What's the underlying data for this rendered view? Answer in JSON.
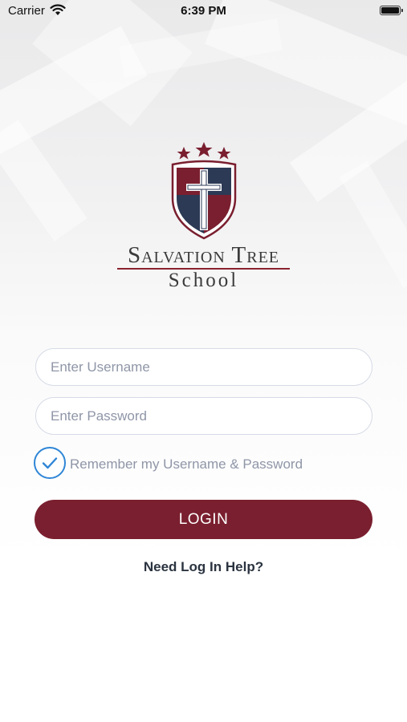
{
  "status_bar": {
    "carrier": "Carrier",
    "time": "6:39 PM"
  },
  "brand": {
    "line1": "Salvation Tree",
    "line2": "School"
  },
  "form": {
    "username": {
      "placeholder": "Enter Username",
      "value": ""
    },
    "password": {
      "placeholder": "Enter Password",
      "value": ""
    },
    "remember_label": "Remember my Username & Password",
    "remember_checked": true,
    "login_label": "LOGIN",
    "help_link": "Need Log In Help?"
  },
  "colors": {
    "primary": "#7a1f2f",
    "navy": "#2c3a55",
    "check": "#2f86d6"
  },
  "icons": {
    "wifi": "wifi-icon",
    "battery": "battery-icon",
    "check": "check-icon",
    "logo": "shield-cross-logo"
  }
}
